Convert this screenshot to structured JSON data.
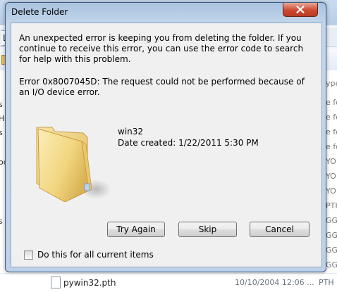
{
  "background": {
    "address_fragment": "Lo",
    "left_pane_fragments": [
      "s",
      "Har",
      "s",
      "oo",
      "s"
    ],
    "right_pane_fragments": [
      "ype",
      "e fo",
      "e fo",
      "e fo",
      "e fo",
      "YO",
      "YO",
      "YO",
      "PTH",
      "GG-",
      "GG-",
      "GG-",
      "GG-"
    ],
    "file_row": {
      "name": "pywin32.pth",
      "date": "10/10/2004 12:06 ...",
      "type": "PTH"
    }
  },
  "dialog": {
    "title": "Delete Folder",
    "message_primary": "An unexpected error is keeping you from deleting the folder. If you continue to receive this error, you can use the error code to search for help with this problem.",
    "message_error": "Error 0x8007045D: The request could not be performed because of an I/O device error.",
    "folder": {
      "name": "win32",
      "date_created": "Date created: 1/22/2011 5:30 PM"
    },
    "buttons": {
      "try_again": "Try Again",
      "skip": "Skip",
      "cancel": "Cancel"
    },
    "checkbox": {
      "label": "Do this for all current items",
      "checked": false
    },
    "icons": {
      "close": "close-icon",
      "folder": "folder-icon"
    },
    "colors": {
      "frame": "#bdd1e8",
      "close_button": "#cd4a32",
      "folder_yellow": "#f2d680"
    }
  }
}
